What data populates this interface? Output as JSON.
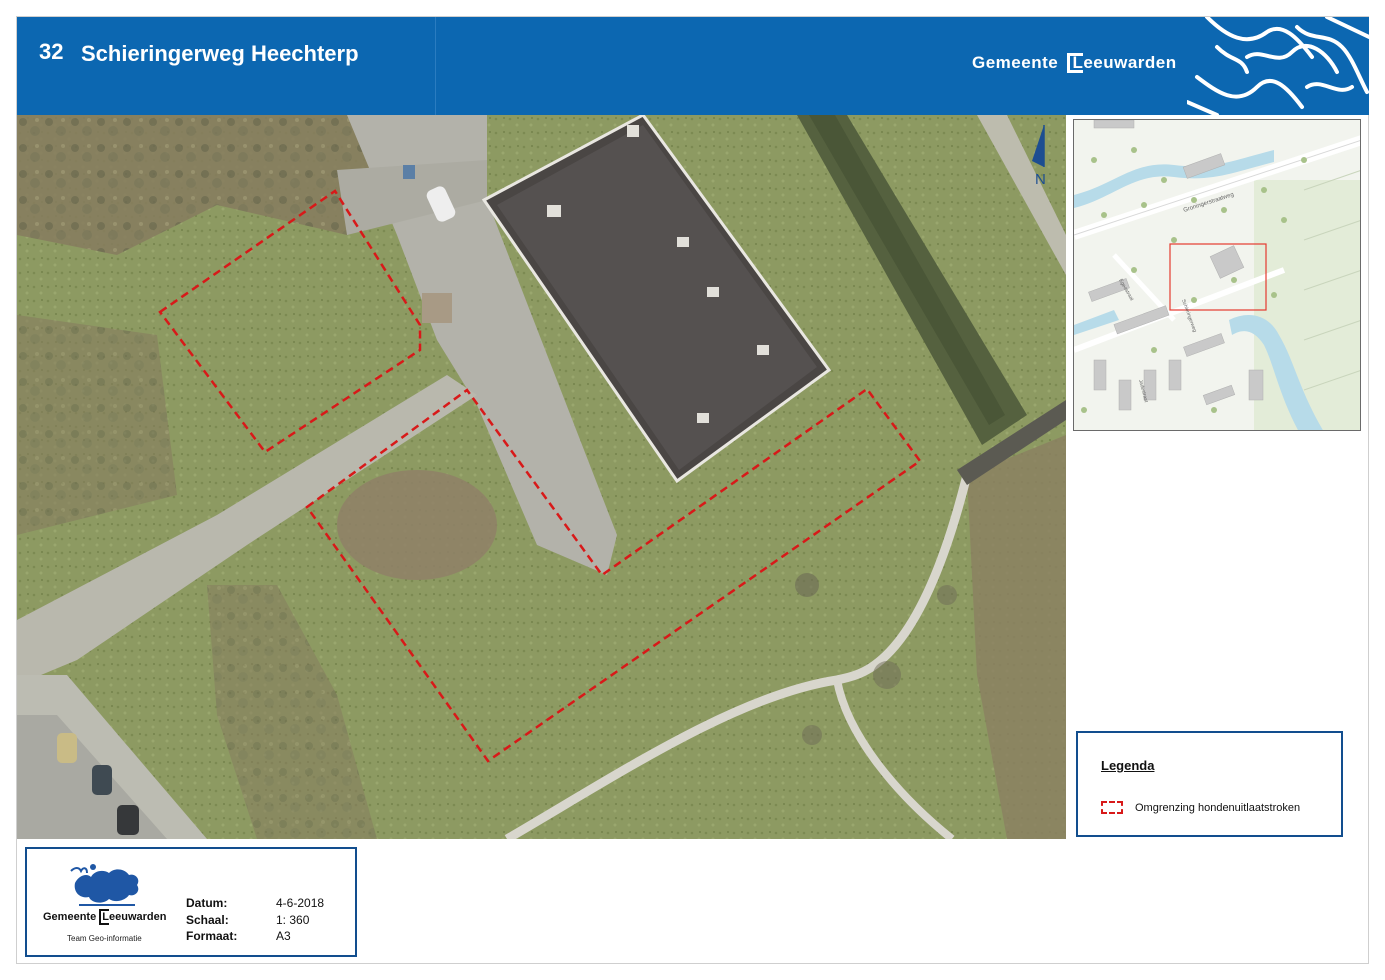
{
  "header": {
    "number": "32",
    "title": "Schieringerweg Heechterp",
    "brand_prefix": "Gemeente ",
    "brand_L": "L",
    "brand_suffix": "eeuwarden"
  },
  "north_arrow": {
    "label": "N"
  },
  "inset_map": {
    "street_labels": [
      "Groningerstraatweg",
      "Schieringerweg",
      "Egeastraat",
      "Jadestraat"
    ],
    "colors": {
      "water": "#b7dbe9",
      "highlight": "#e53a2f"
    }
  },
  "legend": {
    "title": "Legenda",
    "items": [
      {
        "label": "Omgrenzing hondenuitlaatstroken",
        "color": "#d81919"
      }
    ]
  },
  "footer": {
    "brand_prefix": "Gemeente ",
    "brand_L": "L",
    "brand_suffix": "eeuwarden",
    "team": "Team Geo-informatie",
    "fields": [
      {
        "label": "Datum:",
        "value": "4-6-2018"
      },
      {
        "label": "Schaal:",
        "value": "1: 360"
      },
      {
        "label": "Formaat:",
        "value": "A3"
      }
    ]
  },
  "colors": {
    "brand_blue": "#0c67b1",
    "boundary": "#d81919",
    "frame": "#124e8e"
  }
}
